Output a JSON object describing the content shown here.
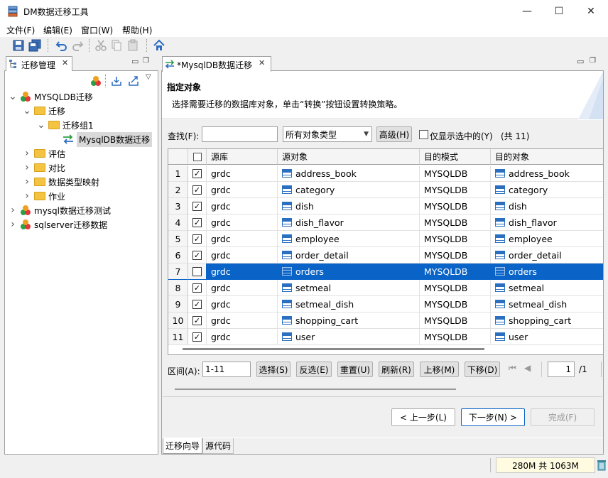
{
  "window": {
    "title": "DM数据迁移工具",
    "minimize": "—",
    "maximize": "☐",
    "close": "✕"
  },
  "menu": [
    "文件(F)",
    "编辑(E)",
    "窗口(W)",
    "帮助(H)"
  ],
  "left_panel": {
    "tab_title": "迁移管理",
    "tree": [
      {
        "label": "MYSQLDB迁移",
        "level": 0,
        "expanded": true,
        "icon": "db-icon"
      },
      {
        "label": "迁移",
        "level": 1,
        "expanded": true,
        "icon": "folder-icon"
      },
      {
        "label": "迁移组1",
        "level": 2,
        "expanded": true,
        "icon": "folder-icon"
      },
      {
        "label": "MysqlDB数据迁移",
        "level": 3,
        "expanded": null,
        "icon": "migrate-icon",
        "selected": true
      },
      {
        "label": "评估",
        "level": 1,
        "expanded": false,
        "icon": "folder-icon"
      },
      {
        "label": "对比",
        "level": 1,
        "expanded": false,
        "icon": "folder-icon"
      },
      {
        "label": "数据类型映射",
        "level": 1,
        "expanded": false,
        "icon": "folder-icon"
      },
      {
        "label": "作业",
        "level": 1,
        "expanded": false,
        "icon": "folder-icon"
      },
      {
        "label": "mysql数据迁移测试",
        "level": 0,
        "expanded": false,
        "icon": "db-icon"
      },
      {
        "label": "sqlserver迁移数据",
        "level": 0,
        "expanded": false,
        "icon": "db-icon"
      }
    ]
  },
  "editor": {
    "tab_title": "*MysqlDB数据迁移",
    "heading": "指定对象",
    "description": "选择需要迁移的数据库对象，单击“转换”按钮设置转换策略。",
    "search_label": "查找(F):",
    "search_value": "",
    "type_filter": "所有对象类型",
    "advanced_button": "高级(H)",
    "only_selected_label": "仅显示选中的(Y)",
    "total_label": "(共 11)",
    "columns": [
      "源库",
      "源对象",
      "目的模式",
      "目的对象"
    ],
    "select_all_header": "",
    "rows": [
      {
        "num": "1",
        "checked": true,
        "src_db": "grdc",
        "src_obj": "address_book",
        "dst_schema": "MYSQLDB",
        "dst_obj": "address_book"
      },
      {
        "num": "2",
        "checked": true,
        "src_db": "grdc",
        "src_obj": "category",
        "dst_schema": "MYSQLDB",
        "dst_obj": "category"
      },
      {
        "num": "3",
        "checked": true,
        "src_db": "grdc",
        "src_obj": "dish",
        "dst_schema": "MYSQLDB",
        "dst_obj": "dish"
      },
      {
        "num": "4",
        "checked": true,
        "src_db": "grdc",
        "src_obj": "dish_flavor",
        "dst_schema": "MYSQLDB",
        "dst_obj": "dish_flavor"
      },
      {
        "num": "5",
        "checked": true,
        "src_db": "grdc",
        "src_obj": "employee",
        "dst_schema": "MYSQLDB",
        "dst_obj": "employee"
      },
      {
        "num": "6",
        "checked": true,
        "src_db": "grdc",
        "src_obj": "order_detail",
        "dst_schema": "MYSQLDB",
        "dst_obj": "order_detail"
      },
      {
        "num": "7",
        "checked": true,
        "src_db": "grdc",
        "src_obj": "orders",
        "dst_schema": "MYSQLDB",
        "dst_obj": "orders",
        "selected": true
      },
      {
        "num": "8",
        "checked": true,
        "src_db": "grdc",
        "src_obj": "setmeal",
        "dst_schema": "MYSQLDB",
        "dst_obj": "setmeal"
      },
      {
        "num": "9",
        "checked": true,
        "src_db": "grdc",
        "src_obj": "setmeal_dish",
        "dst_schema": "MYSQLDB",
        "dst_obj": "setmeal_dish"
      },
      {
        "num": "10",
        "checked": true,
        "src_db": "grdc",
        "src_obj": "shopping_cart",
        "dst_schema": "MYSQLDB",
        "dst_obj": "shopping_cart"
      },
      {
        "num": "11",
        "checked": true,
        "src_db": "grdc",
        "src_obj": "user",
        "dst_schema": "MYSQLDB",
        "dst_obj": "user"
      }
    ],
    "range_label": "区间(A):",
    "range_value": "1-11",
    "range_buttons": [
      "选择(S)",
      "反选(E)",
      "重置(U)",
      "刷新(R)",
      "上移(M)",
      "下移(D)"
    ],
    "page_value": "1",
    "page_total": "/1",
    "nav": {
      "prev": "< 上一步(L)",
      "next": "下一步(N) >",
      "finish": "完成(F)"
    },
    "bottom_tabs": [
      "迁移向导",
      "源代码"
    ]
  },
  "status": {
    "heap": "280M 共 1063M"
  }
}
